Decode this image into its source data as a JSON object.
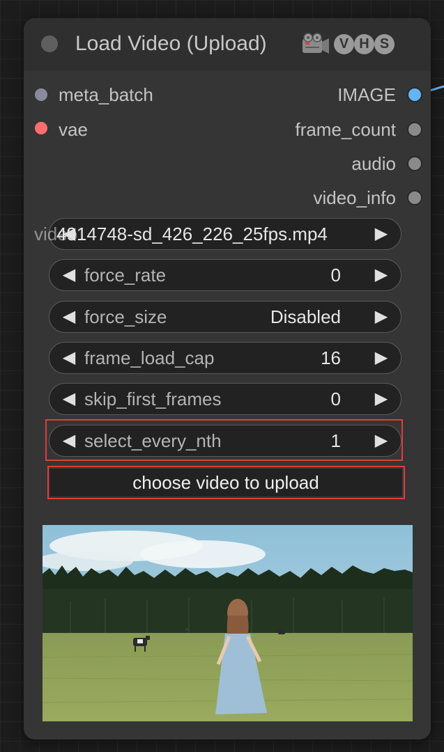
{
  "node": {
    "title": "Load Video (Upload)",
    "camera_icon": "video-camera-icon",
    "badges": [
      "V",
      "H",
      "S"
    ]
  },
  "inputs": [
    {
      "label": "meta_batch",
      "color": "#8a8a9c"
    },
    {
      "label": "vae",
      "color": "#ff6e6e"
    }
  ],
  "outputs": [
    {
      "label": "IMAGE",
      "color": "#64b5f6"
    },
    {
      "label": "frame_count",
      "color": "#8a8a8a"
    },
    {
      "label": "audio",
      "color": "#8a8a8a"
    },
    {
      "label": "video_info",
      "color": "#8a8a8a"
    }
  ],
  "widgets": {
    "video": {
      "label": "video",
      "value": "4914748-sd_426_226_25fps.mp4"
    },
    "force_rate": {
      "label": "force_rate",
      "value": "0"
    },
    "force_size": {
      "label": "force_size",
      "value": "Disabled"
    },
    "frame_load_cap": {
      "label": "frame_load_cap",
      "value": "16"
    },
    "skip_first_frames": {
      "label": "skip_first_frames",
      "value": "0"
    },
    "select_every_nth": {
      "label": "select_every_nth",
      "value": "1"
    }
  },
  "upload_button": {
    "label": "choose video to upload"
  },
  "glyphs": {
    "left": "◀",
    "right": "▶"
  },
  "colors": {
    "highlight": "#e23b3b",
    "node_bg": "#353535",
    "link_wire": "#64b5f6"
  }
}
